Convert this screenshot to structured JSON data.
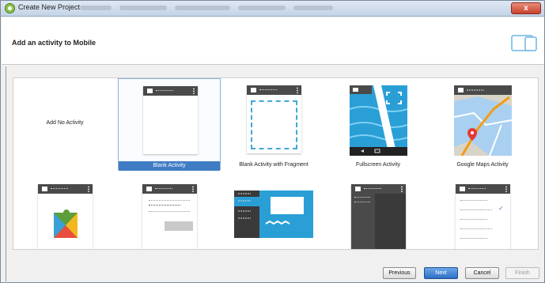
{
  "window": {
    "title": "Create New Project",
    "close_label": "x"
  },
  "header": {
    "heading": "Add an activity to Mobile",
    "device_icon": "tablet-phone-icon"
  },
  "gallery": {
    "tiles": [
      {
        "label": "Add No Activity",
        "selected": false
      },
      {
        "label": "Blank Activity",
        "selected": true
      },
      {
        "label": "Blank Activity with Fragment",
        "selected": false
      },
      {
        "label": "Fullscreen Activity",
        "selected": false
      },
      {
        "label": "Google Maps Activity",
        "selected": false
      },
      {
        "label": "",
        "selected": false
      },
      {
        "label": "",
        "selected": false
      },
      {
        "label": "",
        "selected": false
      },
      {
        "label": "",
        "selected": false
      },
      {
        "label": "",
        "selected": false
      }
    ]
  },
  "buttons": {
    "previous": "Previous",
    "next": "Next",
    "cancel": "Cancel",
    "finish": "Finish"
  },
  "colors": {
    "accent": "#3f7cc4",
    "dashed": "#3fa9d6",
    "fullscreen_bg": "#2a9fd6",
    "maps_route": "#f39c12",
    "pin": "#e53935"
  }
}
